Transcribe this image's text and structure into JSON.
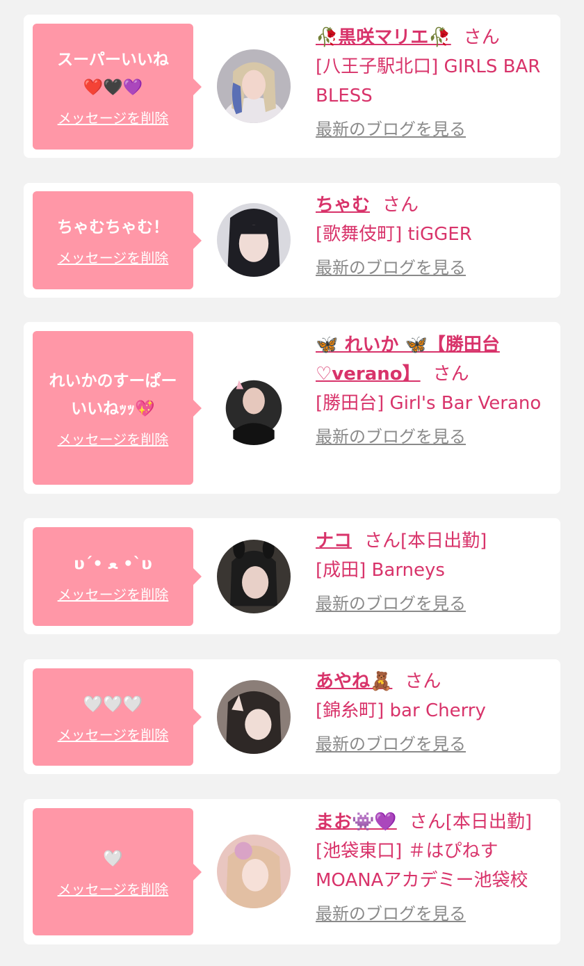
{
  "delete_label": "メッセージを削除",
  "blog_label": "最新のブログを見る",
  "san": "さん",
  "accent_color": "#d8336a",
  "bubble_color": "#ff97a7",
  "items": [
    {
      "message_lines": [
        "スーパーいいね",
        "❤️🖤💜"
      ],
      "name": "🥀黒咲マリエ🥀",
      "suffix": "",
      "store": "[八王子駅北口] GIRLS BAR BLESS"
    },
    {
      "message_lines": [
        "ちゃむちゃむ！"
      ],
      "name": "ちゃむ",
      "suffix": "",
      "store": "[歌舞伎町] tiGGER"
    },
    {
      "message_lines": [
        "れいかのすーぱー",
        "いいねｯｯ💖"
      ],
      "name": "🦋 れいか 🦋【勝田台♡verano】",
      "suffix": "",
      "store": "[勝田台] Girl's Bar Verano"
    },
    {
      "message_lines": [
        "υ´• ﻌ •`υ"
      ],
      "name": "ナコ",
      "suffix": "[本日出勤]",
      "store": "[成田] Barneys"
    },
    {
      "message_lines": [
        "🤍🤍🤍"
      ],
      "name": "あやね🧸",
      "suffix": "",
      "store": "[錦糸町] bar Cherry"
    },
    {
      "message_lines": [
        "🤍"
      ],
      "name": "まお👾💜",
      "suffix": "[本日出勤]",
      "store": "[池袋東口] ＃はぴねす MOANAアカデミー池袋校"
    }
  ]
}
